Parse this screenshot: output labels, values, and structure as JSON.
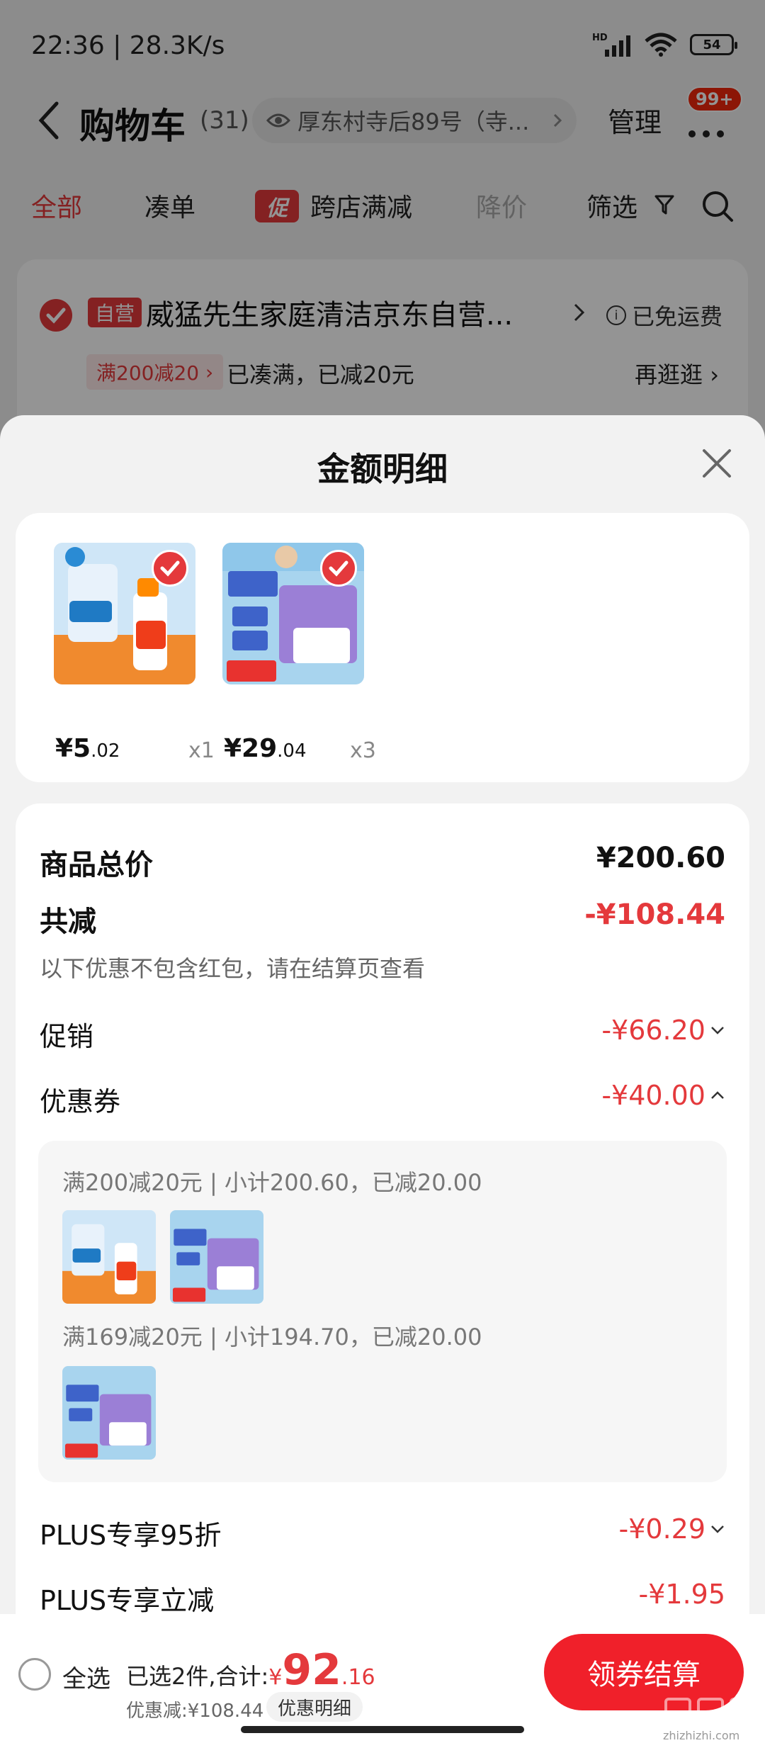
{
  "status_bar": {
    "time": "22:36 | 28.3K/s",
    "network": "HD",
    "battery": "54"
  },
  "header": {
    "title": "购物车",
    "count": "(31)",
    "address": "厚东村寺后89号（寺...",
    "manage": "管理",
    "badge": "99+"
  },
  "tabs": {
    "all": "全部",
    "cudan": "凑单",
    "promo_tag": "促",
    "kuadian": "跨店满减",
    "jiangjia": "降价",
    "shaixuan": "筛选"
  },
  "store": {
    "self_tag": "自营",
    "name": "威猛先生家庭清洁京东自营...",
    "free_shipping": "已免运费",
    "reduce_tag": "满200减20",
    "reduce_text": "已凑满，已减20元",
    "browse_more": "再逛逛"
  },
  "sheet": {
    "title": "金额明细",
    "products": [
      {
        "price_int": "¥5",
        "price_dec": ".02",
        "qty": "x1",
        "icon": "toilet-cleaner-product"
      },
      {
        "price_int": "¥29",
        "price_dec": ".04",
        "qty": "x3",
        "icon": "tissue-product"
      }
    ],
    "rows": {
      "total_label": "商品总价",
      "total_value": "¥200.60",
      "reduce_label": "共减",
      "reduce_value": "-¥108.44",
      "note": "以下优惠不包含红包，请在结算页查看",
      "promo_label": "促销",
      "promo_value": "-¥66.20",
      "coupon_label": "优惠券",
      "coupon_value": "-¥40.00",
      "coupon_line1": "满200减20元 | 小计200.60，已减20.00",
      "coupon_line2": "满169减20元 | 小计194.70，已减20.00",
      "plus95_label": "PLUS专享95折",
      "plus95_value": "-¥0.29",
      "plusreduce_label": "PLUS专享立减",
      "plusreduce_value": "-¥1.95"
    }
  },
  "bottom": {
    "select_all": "全选",
    "summary_prefix": "已选2件,合计:",
    "yen": "¥",
    "total_int": "92",
    "total_dec": ".16",
    "discount": "优惠减:¥108.44",
    "detail_chip": "优惠明细",
    "checkout": "领券结算"
  },
  "watermark": "zhizhizhi.com",
  "colors": {
    "accent": "#e4393c",
    "checkout": "#f0202a"
  }
}
